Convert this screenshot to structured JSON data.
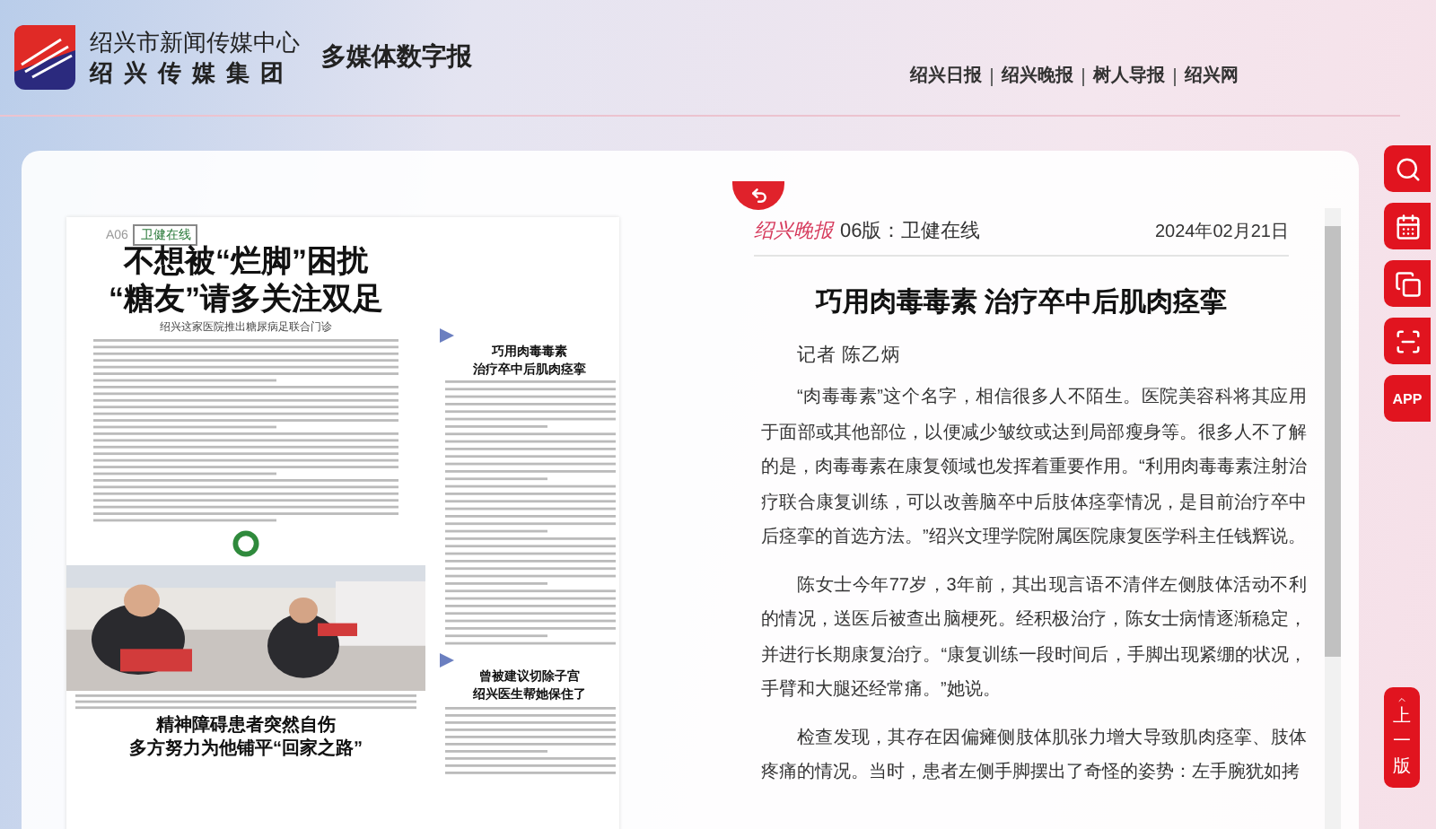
{
  "header": {
    "org_line1": "绍兴市新闻传媒中心",
    "org_line2": "绍兴传媒集团",
    "product": "多媒体数字报",
    "nav": [
      "绍兴日报",
      "绍兴晚报",
      "树人导报",
      "绍兴网"
    ]
  },
  "newspaper_page": {
    "page_no": "A06",
    "section": "卫健在线",
    "lead_headline": [
      "不想被“烂脚”困扰",
      "“糖友”请多关注双足"
    ],
    "lead_subhead": "绍兴这家医院推出糖尿病足联合门诊",
    "photo": {
      "kind": "picture"
    },
    "bottom_headline": [
      "精神障碍患者突然自伤",
      "多方努力为他铺平“回家之路”"
    ],
    "side_articles": [
      {
        "headline": [
          "巧用肉毒毒素",
          "治疗卒中后肌肉痉挛"
        ]
      },
      {
        "headline": [
          "曾被建议切除子宫",
          "绍兴医生帮她保住了"
        ]
      }
    ]
  },
  "article": {
    "paper_name": "绍兴晚报",
    "edition": "06版：卫健在线",
    "date": "2024年02月21日",
    "title": "巧用肉毒毒素 治疗卒中后肌肉痉挛",
    "byline": "记者 陈乙炳",
    "paragraphs": [
      "“肉毒毒素”这个名字，相信很多人不陌生。医院美容科将其应用于面部或其他部位，以便减少皱纹或达到局部瘦身等。很多人不了解的是，肉毒毒素在康复领域也发挥着重要作用。“利用肉毒毒素注射治疗联合康复训练，可以改善脑卒中后肢体痉挛情况，是目前治疗卒中后痉挛的首选方法。”绍兴文理学院附属医院康复医学科主任钱辉说。",
      "陈女士今年77岁，3年前，其出现言语不清伴左侧肢体活动不利的情况，送医后被查出脑梗死。经积极治疗，陈女士病情逐渐稳定，并进行长期康复治疗。“康复训练一段时间后，手脚出现紧绷的状况，手臂和大腿还经常痛。”她说。",
      "检查发现，其存在因偏瘫侧肢体肌张力增大导致肌肉痉挛、肢体疼痛的情况。当时，患者左侧手脚摆出了奇怪的姿势：左手腕犹如拷"
    ]
  },
  "tools": [
    {
      "kind": "search"
    },
    {
      "kind": "calendar"
    },
    {
      "kind": "copy"
    },
    {
      "kind": "scan"
    },
    {
      "kind": "app",
      "label": "APP"
    }
  ],
  "prev_page": {
    "label": "上一版"
  }
}
